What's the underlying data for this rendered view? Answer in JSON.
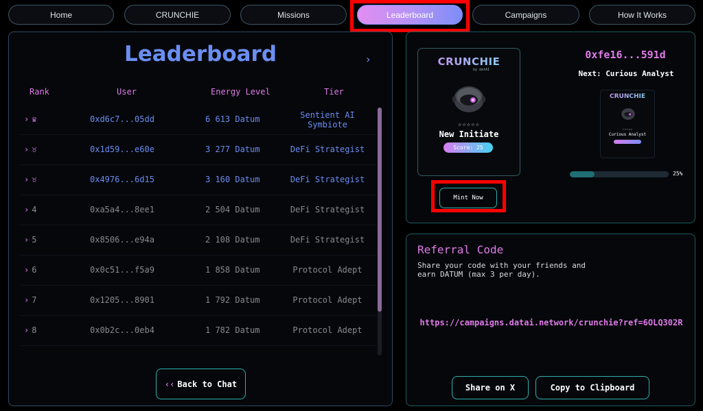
{
  "nav": {
    "tabs": [
      {
        "label": "Home"
      },
      {
        "label": "CRUNCHIE"
      },
      {
        "label": "Missions"
      },
      {
        "label": "Leaderboard",
        "active": true
      },
      {
        "label": "Campaigns"
      },
      {
        "label": "How It Works"
      }
    ]
  },
  "leaderboard": {
    "title": "Leaderboard",
    "chevron": "›",
    "columns": {
      "rank": "Rank",
      "user": "User",
      "energy": "Energy Level",
      "tier": "Tier"
    },
    "rows": [
      {
        "rank": "♛",
        "user": "0xd6c7...05dd",
        "energy": "6 613 Datum",
        "tier": "Sentient AI Symbiote"
      },
      {
        "rank": "♉",
        "user": "0x1d59...e60e",
        "energy": "3 277 Datum",
        "tier": "DeFi Strategist"
      },
      {
        "rank": "♉",
        "user": "0x4976...6d15",
        "energy": "3 160 Datum",
        "tier": "DeFi Strategist"
      },
      {
        "rank": "4",
        "user": "0xa5a4...8ee1",
        "energy": "2 504 Datum",
        "tier": "DeFi Strategist"
      },
      {
        "rank": "5",
        "user": "0x8506...e94a",
        "energy": "2 108 Datum",
        "tier": "DeFi Strategist"
      },
      {
        "rank": "6",
        "user": "0x0c51...f5a9",
        "energy": "1 858 Datum",
        "tier": "Protocol Adept"
      },
      {
        "rank": "7",
        "user": "0x1205...8901",
        "energy": "1 792 Datum",
        "tier": "Protocol Adept"
      },
      {
        "rank": "8",
        "user": "0x0b2c...0eb4",
        "energy": "1 782 Datum",
        "tier": "Protocol Adept"
      }
    ],
    "back_button": "Back to Chat",
    "back_chevron": "‹‹"
  },
  "nft": {
    "logo": "CRUNCHIE",
    "logo_sub": "by datAI",
    "stars": "☆☆☆☆☆",
    "tier_name": "New Initiate",
    "score": "Score: 25",
    "mint_button": "Mint Now",
    "wallet": "0xfe16...591d",
    "next_label": "Next: Curious Analyst",
    "next_card_logo": "CRUNCHIE",
    "next_card_stars": "☆☆☆☆☆",
    "next_card_name": "Curious Analyst",
    "progress_percent": 25,
    "progress_label": "25%"
  },
  "referral": {
    "title": "Referral Code",
    "description": "Share your code with your friends and earn DATUM (max 3 per day).",
    "link": "https://campaigns.datai.network/crunchie?ref=6OLQ302R",
    "share_button": "Share on X",
    "copy_button": "Copy to Clipboard"
  },
  "colors": {
    "accent_blue": "#6b8ef2",
    "accent_pink": "#e07ae8",
    "teal": "#2fb2b2",
    "highlight": "#ff0000"
  }
}
